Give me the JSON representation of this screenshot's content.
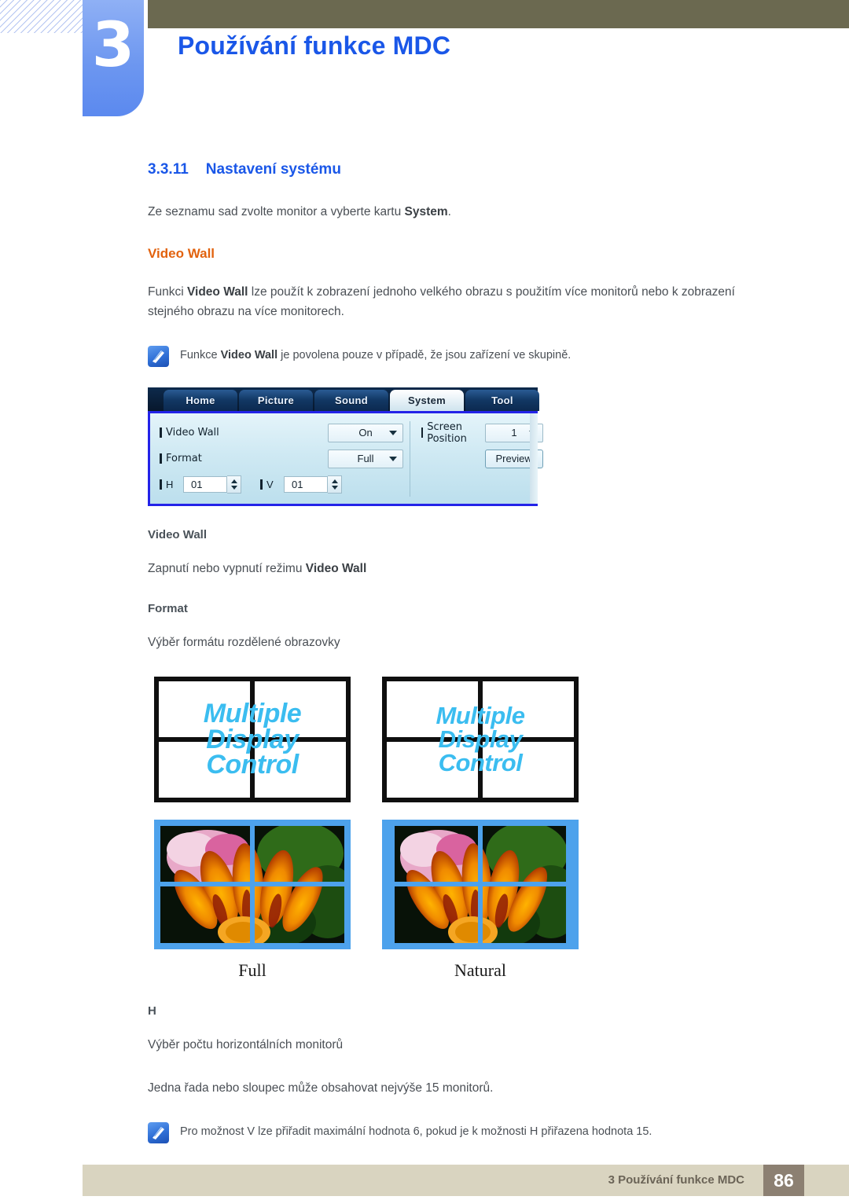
{
  "header": {
    "chapter_number": "3",
    "chapter_title": "Používání funkce MDC"
  },
  "section": {
    "number": "3.3.11",
    "title": "Nastavení systému",
    "intro_prefix": "Ze seznamu sad zvolte monitor a vyberte kartu ",
    "intro_bold": "System",
    "intro_suffix": "."
  },
  "video_wall": {
    "heading": "Video Wall",
    "desc_prefix": "Funkci ",
    "desc_bold": "Video Wall",
    "desc_suffix": " lze použít k zobrazení jednoho velkého obrazu s použitím více monitorů nebo k zobrazení stejného obrazu na více monitorech.",
    "note_prefix": "Funkce ",
    "note_bold": "Video Wall",
    "note_suffix": " je povolena pouze v případě, že jsou zařízení ve skupině."
  },
  "mdc": {
    "tabs": [
      {
        "label": "Home",
        "active": false
      },
      {
        "label": "Picture",
        "active": false
      },
      {
        "label": "Sound",
        "active": false
      },
      {
        "label": "System",
        "active": true
      },
      {
        "label": "Tool",
        "active": false
      }
    ],
    "fields": {
      "video_wall_label": "Video Wall",
      "video_wall_value": "On",
      "format_label": "Format",
      "format_value": "Full",
      "h_label": "H",
      "h_value": "01",
      "v_label": "V",
      "v_value": "01",
      "screen_position_label": "Screen Position",
      "screen_position_value": "1",
      "preview_button": "Preview"
    }
  },
  "descriptions": {
    "video_wall_head": "Video Wall",
    "video_wall_text_prefix": "Zapnutí nebo vypnutí režimu ",
    "video_wall_text_bold": "Video Wall",
    "format_head": "Format",
    "format_text": "Výběr formátu rozdělené obrazovky",
    "h_head": "H",
    "h_text1": "Výběr počtu horizontálních monitorů",
    "h_text2": "Jedna řada nebo sloupec může obsahovat nejvýše 15 monitorů.",
    "h_note": "Pro možnost V lze přiřadit maximální hodnota 6, pokud je k možnosti H přiřazena hodnota 15."
  },
  "diagrams": {
    "wall_text_lines": [
      "Multiple",
      "Display",
      "Control"
    ],
    "caption_full": "Full",
    "caption_natural": "Natural"
  },
  "footer": {
    "text": "3 Používání funkce MDC",
    "page": "86"
  },
  "colors": {
    "accent_blue": "#1a57e8",
    "accent_orange": "#e2620e",
    "olive": "#6b6950",
    "footer_bar": "#d9d4c0",
    "footer_page": "#8c8072",
    "wall_text": "#3bbdf0",
    "photo_border": "#4da2ec",
    "mdc_panel_border": "#2323e8"
  }
}
